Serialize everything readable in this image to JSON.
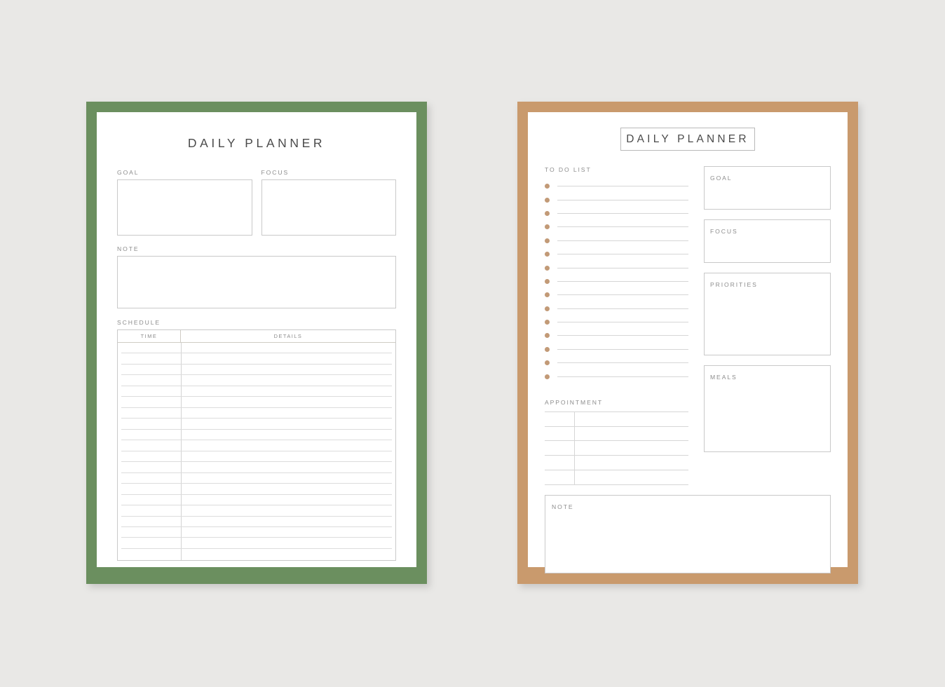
{
  "theme": {
    "page_background": "#e9e8e6",
    "green_frame": "#6b8f5f",
    "tan_frame": "#c99a6d",
    "sheet_background": "#ffffff",
    "outline": "#c9c9c9",
    "rule_line": "#d6d6d6",
    "label_text": "#8d8d8d",
    "title_text": "#4b4b4b",
    "bullet": "#c29a77"
  },
  "green_planner": {
    "title": "DAILY PLANNER",
    "goal_label": "GOAL",
    "focus_label": "FOCUS",
    "note_label": "NOTE",
    "schedule_label": "SCHEDULE",
    "schedule_columns": [
      "TIME",
      "DETAILS"
    ],
    "schedule_row_count": 20,
    "schedule_rows": [
      {
        "time": "",
        "details": ""
      },
      {
        "time": "",
        "details": ""
      },
      {
        "time": "",
        "details": ""
      },
      {
        "time": "",
        "details": ""
      },
      {
        "time": "",
        "details": ""
      },
      {
        "time": "",
        "details": ""
      },
      {
        "time": "",
        "details": ""
      },
      {
        "time": "",
        "details": ""
      },
      {
        "time": "",
        "details": ""
      },
      {
        "time": "",
        "details": ""
      },
      {
        "time": "",
        "details": ""
      },
      {
        "time": "",
        "details": ""
      },
      {
        "time": "",
        "details": ""
      },
      {
        "time": "",
        "details": ""
      },
      {
        "time": "",
        "details": ""
      },
      {
        "time": "",
        "details": ""
      },
      {
        "time": "",
        "details": ""
      },
      {
        "time": "",
        "details": ""
      },
      {
        "time": "",
        "details": ""
      },
      {
        "time": "",
        "details": ""
      }
    ],
    "goal_value": "",
    "focus_value": "",
    "note_value": ""
  },
  "tan_planner": {
    "title": "DAILY PLANNER",
    "todo_label": "TO DO LIST",
    "todo_item_count": 15,
    "todo_items": [
      "",
      "",
      "",
      "",
      "",
      "",
      "",
      "",
      "",
      "",
      "",
      "",
      "",
      "",
      ""
    ],
    "appointment_label": "APPOINTMENT",
    "appointment_row_count": 5,
    "appointment_rows": [
      {
        "time": "",
        "detail": ""
      },
      {
        "time": "",
        "detail": ""
      },
      {
        "time": "",
        "detail": ""
      },
      {
        "time": "",
        "detail": ""
      },
      {
        "time": "",
        "detail": ""
      }
    ],
    "goal_label": "GOAL",
    "goal_value": "",
    "focus_label": "FOCUS",
    "focus_value": "",
    "priorities_label": "PRIORITIES",
    "priorities_value": "",
    "meals_label": "MEALS",
    "meals_value": "",
    "note_label": "NOTE",
    "note_value": ""
  }
}
